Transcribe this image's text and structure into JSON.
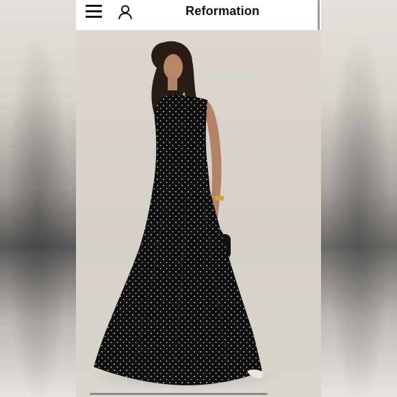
{
  "header": {
    "brand": "Reformation",
    "menu_icon": "hamburger-menu-icon",
    "account_icon": "user-account-icon"
  },
  "hero": {
    "image": "model-in-black-polka-dot-maxi-dress"
  },
  "colors": {
    "header_bg": "#ffffff",
    "dress": "#0f0f10",
    "background": "#dcd6cf"
  }
}
